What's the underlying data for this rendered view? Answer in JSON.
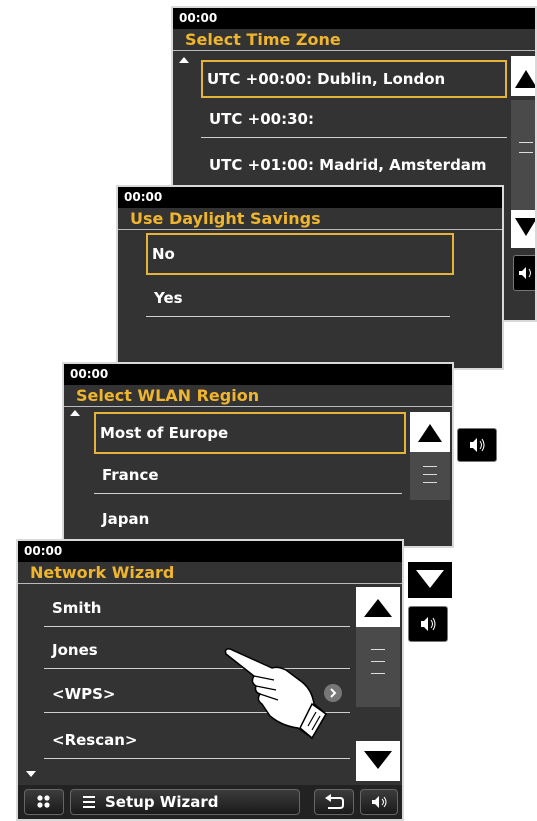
{
  "screen_timezone": {
    "clock": "00:00",
    "title": "Select Time Zone",
    "items": [
      {
        "label": "UTC +00:00: Dublin, London"
      },
      {
        "label": "UTC +00:30:"
      },
      {
        "label": "UTC +01:00: Madrid, Amsterdam"
      }
    ]
  },
  "screen_daylight": {
    "clock": "00:00",
    "title": "Use Daylight Savings",
    "items": [
      {
        "label": "No"
      },
      {
        "label": "Yes"
      }
    ]
  },
  "screen_wlan": {
    "clock": "00:00",
    "title": "Select WLAN Region",
    "items": [
      {
        "label": "Most of Europe"
      },
      {
        "label": "France"
      },
      {
        "label": "Japan"
      }
    ]
  },
  "screen_network": {
    "clock": "00:00",
    "title": "Network Wizard",
    "items": [
      {
        "label": "Smith"
      },
      {
        "label": "Jones"
      },
      {
        "label": "<WPS>"
      },
      {
        "label": "<Rescan>"
      }
    ],
    "bottom_bar": {
      "setup_label": "Setup Wizard"
    }
  },
  "colors": {
    "accent": "#f0b52f",
    "panel": "#333333",
    "selection": "#e6b33a"
  },
  "icons": [
    "scroll-up-icon",
    "scroll-down-icon",
    "volume-icon",
    "home-grid-icon",
    "menu-icon",
    "back-icon",
    "chevron-right-icon",
    "pointing-hand-icon"
  ]
}
